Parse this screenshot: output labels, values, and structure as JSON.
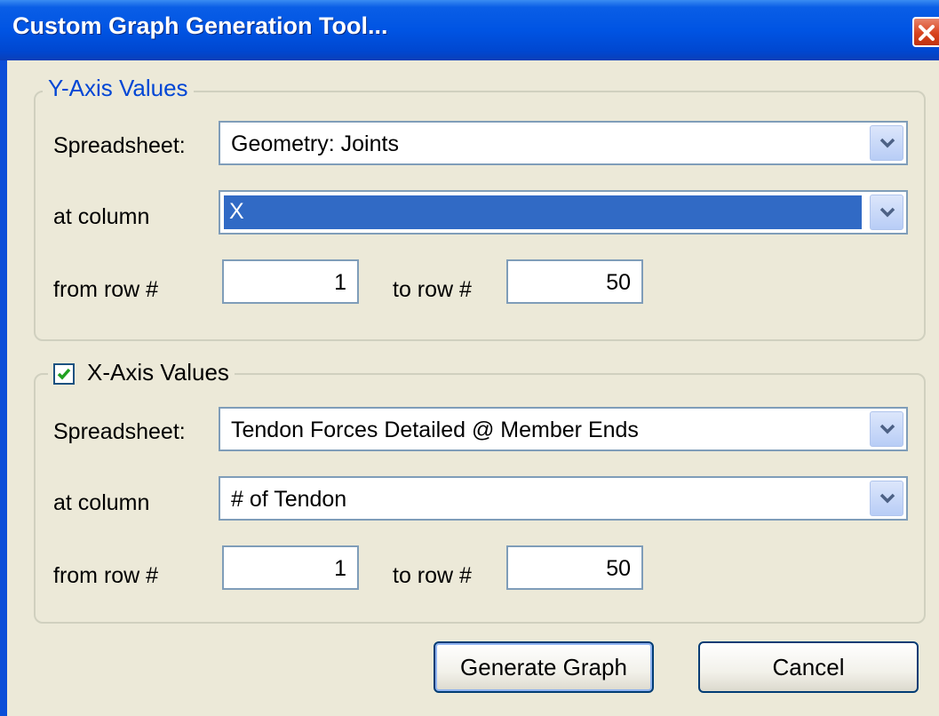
{
  "window": {
    "title": "Custom Graph Generation Tool...",
    "close_icon": "close-icon"
  },
  "y_axis": {
    "legend": "Y-Axis Values",
    "spreadsheet_label": "Spreadsheet:",
    "spreadsheet_value": "Geometry: Joints",
    "column_label": "at column",
    "column_value": "X",
    "from_label": "from row #",
    "from_value": "1",
    "to_label": "to row #",
    "to_value": "50"
  },
  "x_axis": {
    "checked": true,
    "legend": "X-Axis Values",
    "spreadsheet_label": "Spreadsheet:",
    "spreadsheet_value": "Tendon Forces Detailed @ Member Ends",
    "column_label": "at column",
    "column_value": "# of Tendon",
    "from_label": "from row #",
    "from_value": "1",
    "to_label": "to row #",
    "to_value": "50"
  },
  "buttons": {
    "generate": "Generate Graph",
    "cancel": "Cancel"
  },
  "colors": {
    "title_bar": "#0054e3",
    "dialog_bg": "#ece9d8",
    "selection": "#316ac5",
    "legend_blue": "#0046d5"
  }
}
